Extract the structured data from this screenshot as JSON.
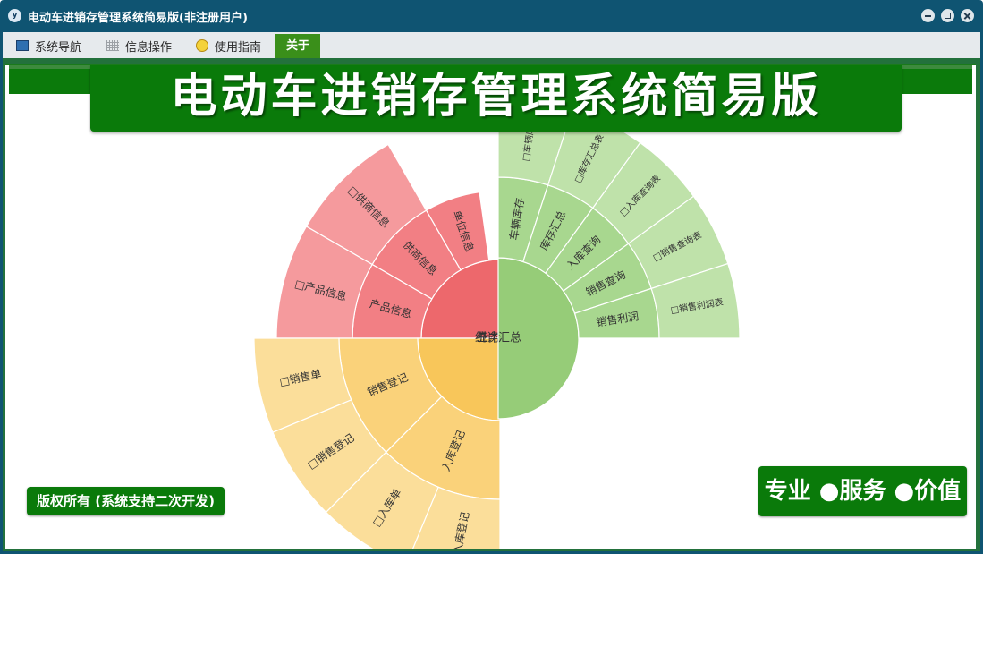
{
  "window": {
    "title": "电动车进销存管理系统简易版(非注册用户)",
    "icon": "app-logo-icon"
  },
  "menu": [
    {
      "label": "系统导航",
      "icon": "nav-icon"
    },
    {
      "label": "信息操作",
      "icon": "grid-icon"
    },
    {
      "label": "使用指南",
      "icon": "guide-icon"
    },
    {
      "label": "关于",
      "active": true
    }
  ],
  "banner_title": "电动车进销存管理系统简易版",
  "copyright": "版权所有 (系统支持二次开发)",
  "slogan": "专业 ●服务 ●价值",
  "colors": {
    "window_frame": "#0f5472",
    "banner_green": "#0a7a0a",
    "red_core": "#ed686c",
    "red_mid": "#f27f84",
    "red_outer": "#f59a9d",
    "yellow_core": "#f8c65a",
    "yellow_mid": "#fad27a",
    "yellow_outer": "#fbde9a",
    "green_core": "#96cc78",
    "green_mid": "#a8d78f",
    "green_outer": "#bfe2aa"
  },
  "sunburst": {
    "groups": [
      {
        "label": "基本信息",
        "children": [
          {
            "label": "单位信息",
            "children": []
          },
          {
            "label": "供商信息",
            "children": [
              {
                "label": "□供商信息"
              }
            ]
          },
          {
            "label": "产品信息",
            "children": [
              {
                "label": "□产品信息"
              }
            ]
          }
        ]
      },
      {
        "label": "统计汇总",
        "children": [
          {
            "label": "车辆库存",
            "children": [
              {
                "label": "□车辆库存"
              }
            ]
          },
          {
            "label": "库存汇总",
            "children": [
              {
                "label": "□库存汇总表"
              }
            ]
          },
          {
            "label": "入库查询",
            "children": [
              {
                "label": "□入库查询表"
              }
            ]
          },
          {
            "label": "销售查询",
            "children": [
              {
                "label": "□销售查询表"
              }
            ]
          },
          {
            "label": "销售利润",
            "children": [
              {
                "label": "□销售利润表"
              }
            ]
          }
        ]
      },
      {
        "label": "业务管理",
        "children": [
          {
            "label": "销售登记",
            "children": [
              {
                "label": "□销售单"
              },
              {
                "label": "□销售登记"
              }
            ]
          },
          {
            "label": "入库登记",
            "children": [
              {
                "label": "□入库单"
              },
              {
                "label": "□入库登记"
              }
            ]
          }
        ]
      }
    ]
  }
}
